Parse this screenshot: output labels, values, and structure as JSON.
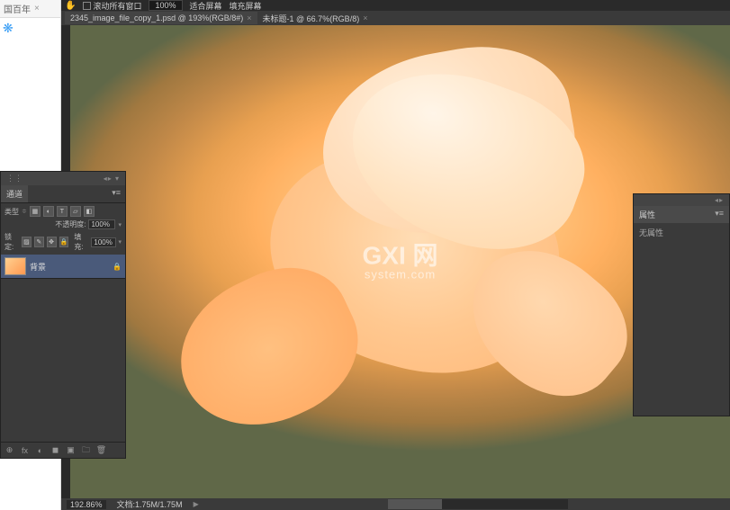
{
  "browser": {
    "tab_label": "国百年",
    "fav_glyph": "❋"
  },
  "toolbar": {
    "hand_glyph": "✋",
    "scroll_label": "滚动所有窗口",
    "zoom_value": "100%",
    "fit_screen": "适合屏幕",
    "fill_screen": "填充屏幕"
  },
  "doc_tabs": [
    {
      "label": "2345_image_file_copy_1.psd @ 193%(RGB/8#)"
    },
    {
      "label": "未标题-1 @ 66.7%(RGB/8)"
    }
  ],
  "watermark": {
    "main": "GXI 网",
    "sub": "system.com"
  },
  "layers_panel": {
    "tab_channel": "通道",
    "type_label": "类型",
    "opacity_label": "不透明度:",
    "opacity_value": "100%",
    "lock_label": "锁定:",
    "fill_label": "填充:",
    "fill_value": "100%",
    "layer_name": "背景",
    "lock_glyph": "🔒",
    "footer_icons": [
      "⊕",
      "fx",
      "◐",
      "◼",
      "▣",
      "🗀",
      "🗑"
    ]
  },
  "props_panel": {
    "title": "属性",
    "body": "无属性"
  },
  "statusbar": {
    "zoom": "192.86%",
    "doc_info": "文档:1.75M/1.75M"
  }
}
